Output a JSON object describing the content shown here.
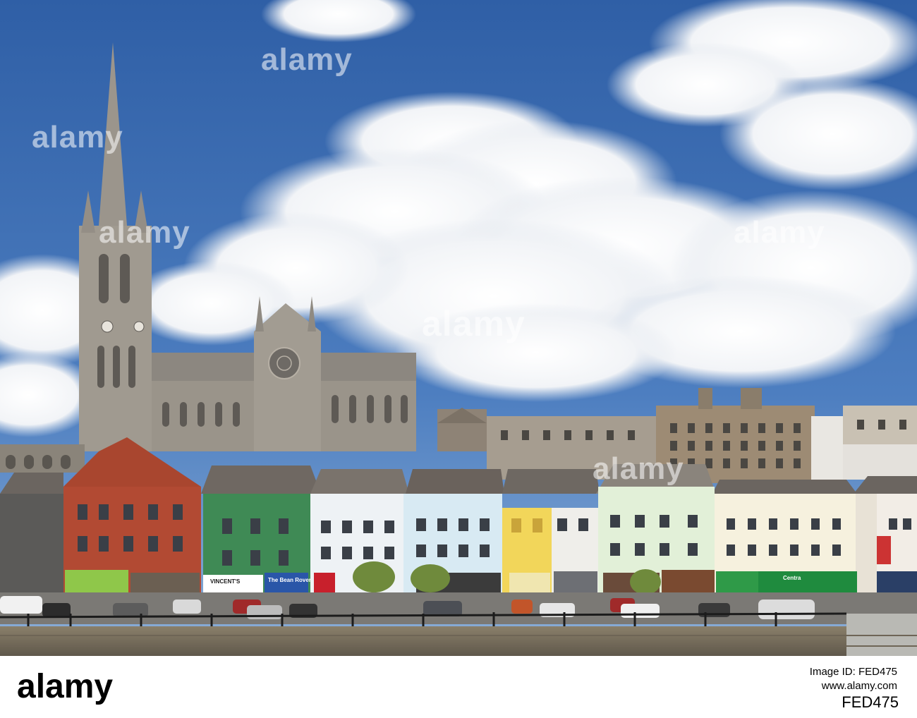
{
  "watermark": {
    "center_text": "alamy",
    "repeat_text": "alamy",
    "color": "#ffffff"
  },
  "footer": {
    "logo": "alamy",
    "image_id_label": "Image ID: FED475",
    "site": "www.alamy.com",
    "image_id": "FED475"
  },
  "scene": {
    "sky_color": "#3f6fb1",
    "sky_light": "#8fb3dc",
    "shop_signs": [
      "VINCENT'S",
      "The Bean Rover",
      "Centra"
    ]
  }
}
